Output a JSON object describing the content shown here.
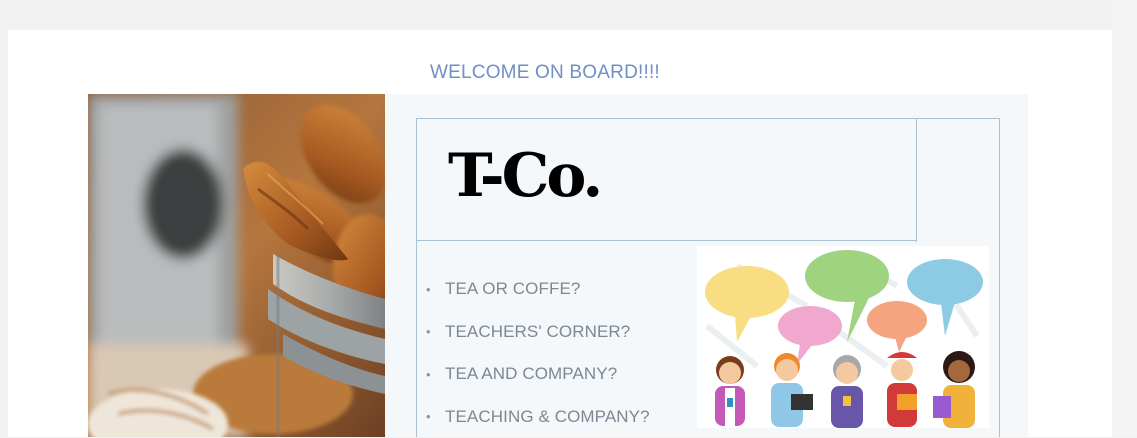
{
  "page": {
    "heading": "WELCOME ON BOARD!!!!"
  },
  "slide": {
    "logo": "T-Co.",
    "menu": [
      "TEA OR COFFE?",
      "TEACHERS' CORNER?",
      "TEA AND COMPANY?",
      "TEACHING & COMPANY?"
    ]
  },
  "colors": {
    "heading": "#6f8fc7",
    "frame": "#a9c2d3",
    "menu_text": "#7d8893",
    "bubble_yellow": "#f8dd82",
    "bubble_green": "#9fd37f",
    "bubble_pink": "#f0a8cf",
    "bubble_orange": "#f4a47f",
    "bubble_blue": "#8ccbe3"
  },
  "images": {
    "photo": "croissants-basket-photo",
    "illustration": "people-speech-bubbles-illustration"
  }
}
